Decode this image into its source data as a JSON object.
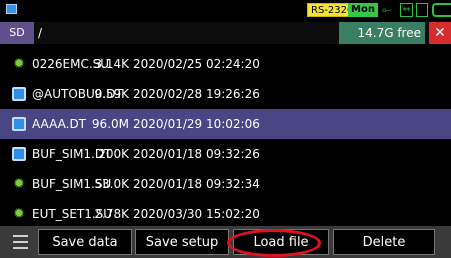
{
  "status": {
    "rs232c": "RS-232C",
    "mon": "Mon"
  },
  "path": {
    "drive": "SD",
    "dir": "/",
    "free": "14.7G free",
    "close": "✕"
  },
  "files": [
    {
      "icon": "gear",
      "name": "0226EMC.SU",
      "size": "3.14K",
      "datetime": "2020/02/25 02:24:20",
      "selected": false
    },
    {
      "icon": "folder",
      "name": "@AUTOBU0.DT",
      "size": "9.59K",
      "datetime": "2020/02/28 19:26:26",
      "selected": false
    },
    {
      "icon": "folder",
      "name": "AAAA.DT",
      "size": "96.0M",
      "datetime": "2020/01/29 10:02:06",
      "selected": true
    },
    {
      "icon": "folder",
      "name": "BUF_SIM1.DT",
      "size": "200K",
      "datetime": "2020/01/18 09:32:26",
      "selected": false
    },
    {
      "icon": "gear",
      "name": "BUF_SIM1.SU",
      "size": "53.0K",
      "datetime": "2020/01/18 09:32:34",
      "selected": false
    },
    {
      "icon": "gear",
      "name": "EUT_SET1.SU",
      "size": "2.78K",
      "datetime": "2020/03/30 15:02:20",
      "selected": false
    }
  ],
  "toolbar": {
    "save_data": "Save data",
    "save_setup": "Save setup",
    "load_file": "Load file",
    "delete": "Delete"
  },
  "colors": {
    "selected_row": "#4a4585",
    "highlight_circle": "#e0121a"
  }
}
